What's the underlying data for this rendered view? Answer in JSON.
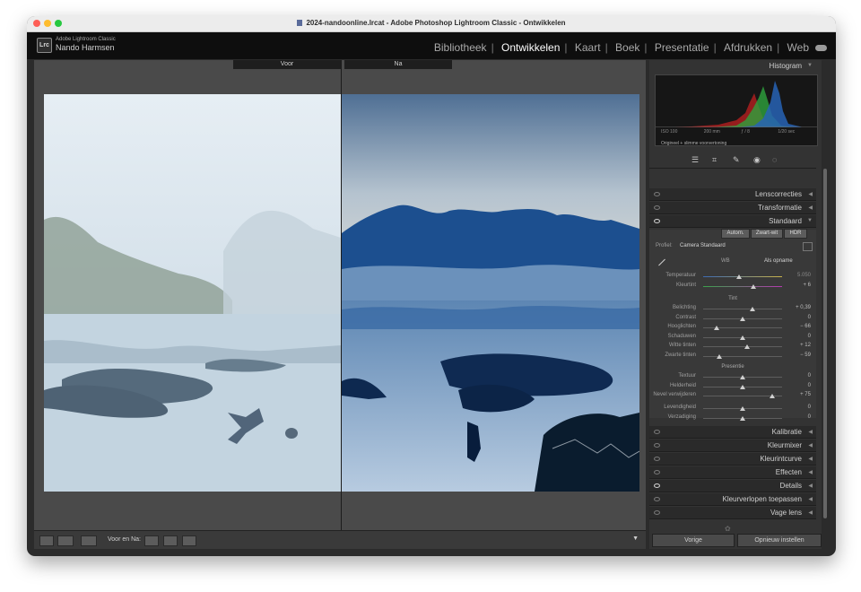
{
  "window": {
    "title": "2024-nandoonline.lrcat - Adobe Photoshop Lightroom Classic - Ontwikkelen"
  },
  "identity": {
    "app": "Adobe Lightroom Classic",
    "user": "Nando Harmsen",
    "badge": "Lrc"
  },
  "modules": [
    "Bibliotheek",
    "Ontwikkelen",
    "Kaart",
    "Boek",
    "Presentatie",
    "Afdrukken",
    "Web"
  ],
  "active_module": "Ontwikkelen",
  "view": {
    "before_label": "Voor",
    "after_label": "Na"
  },
  "toolbar": {
    "before_after_label": "Voor en Na:"
  },
  "histogram": {
    "title": "Histogram",
    "iso": "ISO 100",
    "focal": "200 mm",
    "aperture": "ƒ / 8",
    "shutter": "1/20 sec",
    "preview": "Origineel + slimme voorvertoning"
  },
  "panels": {
    "lens": "Lenscorrecties",
    "transform": "Transformatie",
    "basic": "Standaard",
    "calibration": "Kalibratie",
    "mixer": "Kleurmixer",
    "curve": "Kleurintcurve",
    "effects": "Effecten",
    "details": "Details",
    "gradients": "Kleurverlopen toepassen",
    "haze": "Vage lens"
  },
  "basic": {
    "autom": "Autom.",
    "bw": "Zwart-wit",
    "hdr": "HDR",
    "profile_label": "Profiel:",
    "profile_value": "Camera Standaard",
    "wb_label": "WB",
    "wb_value": "Als opname",
    "temp_label": "Temperatuur",
    "temp_value": "5.050",
    "tint_label": "Kleurtint",
    "tint_value": "+ 6",
    "tone_heading": "Tint",
    "sliders_tone": [
      {
        "label": "Belichting",
        "value": "+ 0,39",
        "pos": 0.62
      },
      {
        "label": "Contrast",
        "value": "0",
        "pos": 0.5
      },
      {
        "label": "Hooglichten",
        "value": "− 66",
        "pos": 0.17
      },
      {
        "label": "Schaduwen",
        "value": "0",
        "pos": 0.5
      },
      {
        "label": "Witte tinten",
        "value": "+ 12",
        "pos": 0.56
      },
      {
        "label": "Zwarte tinten",
        "value": "− 59",
        "pos": 0.2
      }
    ],
    "presence_heading": "Presentie",
    "sliders_presence": [
      {
        "label": "Textuur",
        "value": "0",
        "pos": 0.5
      },
      {
        "label": "Helderheid",
        "value": "0",
        "pos": 0.5
      },
      {
        "label": "Nevel verwijderen",
        "value": "+ 75",
        "pos": 0.87
      }
    ],
    "sliders_color": [
      {
        "label": "Levendigheid",
        "value": "0",
        "pos": 0.5
      },
      {
        "label": "Verzadiging",
        "value": "0",
        "pos": 0.5
      }
    ]
  },
  "footer": {
    "previous": "Vorige",
    "reset": "Opnieuw instellen"
  }
}
